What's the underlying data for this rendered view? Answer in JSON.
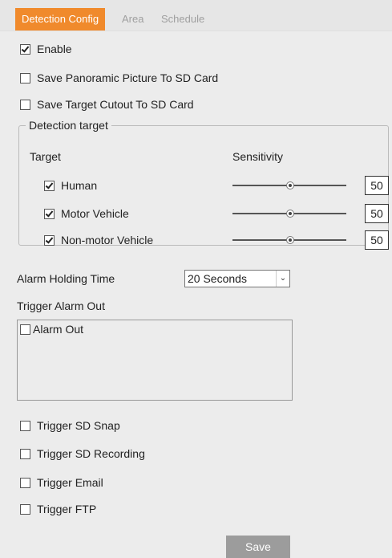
{
  "tabs": {
    "detection_config": "Detection Config",
    "area": "Area",
    "schedule": "Schedule"
  },
  "options": {
    "enable": {
      "label": "Enable",
      "checked": true
    },
    "save_panoramic": {
      "label": "Save Panoramic Picture To SD Card",
      "checked": false
    },
    "save_cutout": {
      "label": "Save Target Cutout To SD Card",
      "checked": false
    }
  },
  "detection_target": {
    "legend": "Detection target",
    "target_header": "Target",
    "sensitivity_header": "Sensitivity",
    "targets": [
      {
        "label": "Human",
        "checked": true,
        "sensitivity": "50"
      },
      {
        "label": "Motor Vehicle",
        "checked": true,
        "sensitivity": "50"
      },
      {
        "label": "Non-motor Vehicle",
        "checked": true,
        "sensitivity": "50"
      }
    ]
  },
  "alarm_holding": {
    "label": "Alarm Holding Time",
    "value": "20 Seconds"
  },
  "trigger_alarm_out": {
    "label": "Trigger Alarm Out",
    "items": [
      {
        "label": "Alarm Out",
        "checked": false
      }
    ]
  },
  "triggers": {
    "sd_snap": {
      "label": "Trigger SD Snap",
      "checked": false
    },
    "sd_recording": {
      "label": "Trigger SD Recording",
      "checked": false
    },
    "email": {
      "label": "Trigger Email",
      "checked": false
    },
    "ftp": {
      "label": "Trigger FTP",
      "checked": false
    }
  },
  "save_label": "Save",
  "colors": {
    "accent": "#f08a2c",
    "button": "#9c9c9c",
    "background": "#ececec"
  }
}
